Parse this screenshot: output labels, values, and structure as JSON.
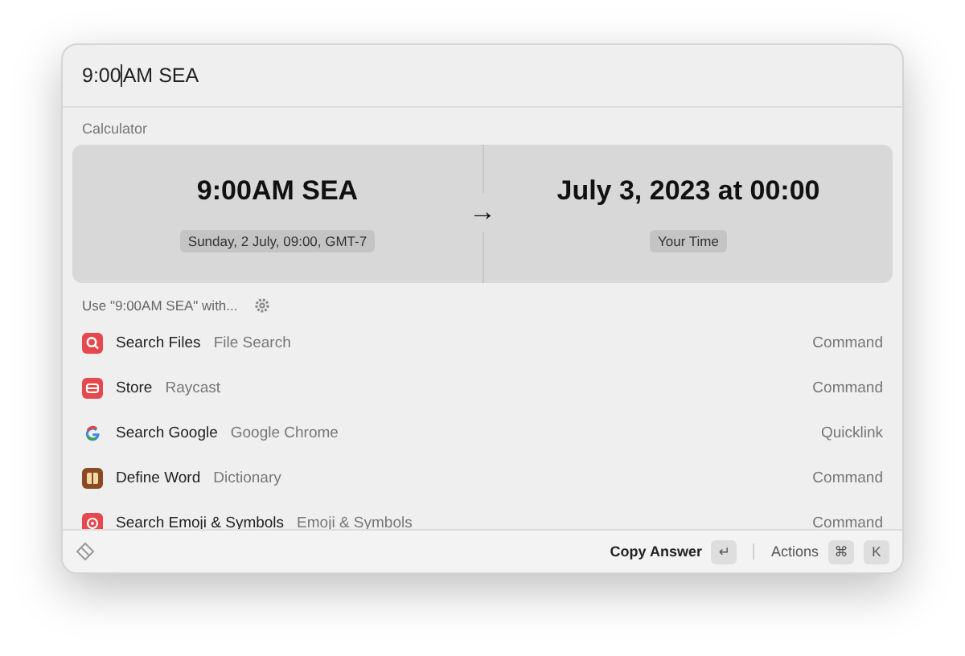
{
  "search": {
    "value_before_cursor": "9:00",
    "value_after_cursor": "AM SEA"
  },
  "calculator": {
    "label": "Calculator",
    "from": {
      "value": "9:00AM SEA",
      "detail": "Sunday, 2 July, 09:00, GMT-7"
    },
    "arrow": "→",
    "to": {
      "value": "July 3, 2023 at 00:00",
      "detail": "Your Time"
    }
  },
  "section": {
    "label": "Use \"9:00AM SEA\" with..."
  },
  "items": [
    {
      "kind": "search",
      "title": "Search Files",
      "subtitle": "File Search",
      "type": "Command"
    },
    {
      "kind": "store",
      "title": "Store",
      "subtitle": "Raycast",
      "type": "Command"
    },
    {
      "kind": "google",
      "title": "Search Google",
      "subtitle": "Google Chrome",
      "type": "Quicklink"
    },
    {
      "kind": "book",
      "title": "Define Word",
      "subtitle": "Dictionary",
      "type": "Command"
    },
    {
      "kind": "emoji",
      "title": "Search Emoji & Symbols",
      "subtitle": "Emoji & Symbols",
      "type": "Command"
    }
  ],
  "footer": {
    "primary_action": "Copy Answer",
    "primary_key": "↵",
    "actions_label": "Actions",
    "action_keys": [
      "⌘",
      "K"
    ]
  }
}
